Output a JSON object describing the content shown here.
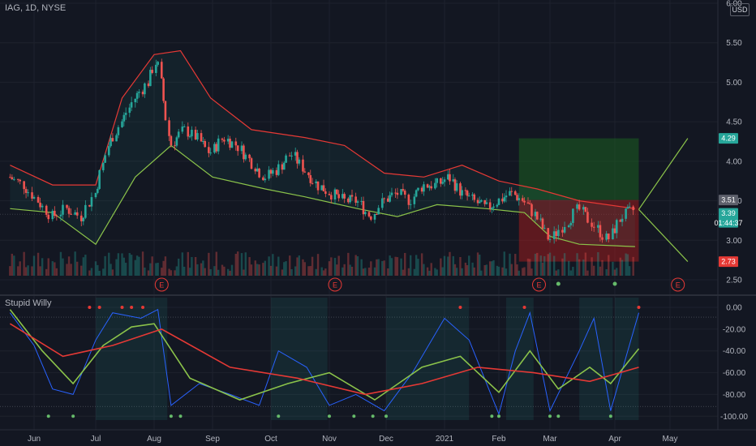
{
  "header": {
    "symbol": "IAG, 1D, NYSE",
    "currency": "USD"
  },
  "indicator": {
    "name": "Stupid Willy"
  },
  "colors": {
    "bg": "#131722",
    "grid": "#1e222d",
    "up": "#26a69a",
    "down": "#ef5350",
    "bb_upper": "#e53935",
    "bb_lower": "#8bc34a",
    "osc_fast": "#2962ff",
    "osc_slow": "#8bc34a",
    "osc_mid": "#e53935"
  },
  "price_badges": {
    "tp": "4.29",
    "entry": "3.51",
    "last": "3.39",
    "countdown": "01:44:37",
    "sl": "2.73"
  },
  "earnings_marker": "E",
  "chart_data": [
    {
      "type": "candlestick",
      "title": "IAG, 1D, NYSE",
      "x_ticks": [
        "Jun",
        "Jul",
        "Aug",
        "Sep",
        "Oct",
        "Nov",
        "Dec",
        "2021",
        "Feb",
        "Mar",
        "Apr",
        "May"
      ],
      "y_ticks": [
        "2.50",
        "3.00",
        "3.50",
        "4.00",
        "4.50",
        "5.00",
        "5.50",
        "6.00"
      ],
      "ylim": [
        2.5,
        6.0
      ],
      "close_path": [
        {
          "date": "2020-05-20",
          "price": 3.8
        },
        {
          "date": "2020-05-27",
          "price": 3.7
        },
        {
          "date": "2020-06-03",
          "price": 3.5
        },
        {
          "date": "2020-06-10",
          "price": 3.3
        },
        {
          "date": "2020-06-17",
          "price": 3.4
        },
        {
          "date": "2020-06-24",
          "price": 3.3
        },
        {
          "date": "2020-07-01",
          "price": 3.6
        },
        {
          "date": "2020-07-08",
          "price": 4.2
        },
        {
          "date": "2020-07-15",
          "price": 4.5
        },
        {
          "date": "2020-07-22",
          "price": 4.8
        },
        {
          "date": "2020-07-29",
          "price": 5.0
        },
        {
          "date": "2020-08-03",
          "price": 5.3
        },
        {
          "date": "2020-08-10",
          "price": 4.2
        },
        {
          "date": "2020-08-17",
          "price": 4.4
        },
        {
          "date": "2020-08-24",
          "price": 4.3
        },
        {
          "date": "2020-08-31",
          "price": 4.1
        },
        {
          "date": "2020-09-07",
          "price": 4.3
        },
        {
          "date": "2020-09-14",
          "price": 4.2
        },
        {
          "date": "2020-09-21",
          "price": 4.0
        },
        {
          "date": "2020-09-28",
          "price": 3.8
        },
        {
          "date": "2020-10-05",
          "price": 3.9
        },
        {
          "date": "2020-10-12",
          "price": 4.1
        },
        {
          "date": "2020-10-19",
          "price": 3.9
        },
        {
          "date": "2020-10-26",
          "price": 3.7
        },
        {
          "date": "2020-11-02",
          "price": 3.6
        },
        {
          "date": "2020-11-09",
          "price": 3.5
        },
        {
          "date": "2020-11-16",
          "price": 3.5
        },
        {
          "date": "2020-11-23",
          "price": 3.3
        },
        {
          "date": "2020-11-30",
          "price": 3.5
        },
        {
          "date": "2020-12-07",
          "price": 3.6
        },
        {
          "date": "2020-12-14",
          "price": 3.5
        },
        {
          "date": "2020-12-21",
          "price": 3.7
        },
        {
          "date": "2020-12-28",
          "price": 3.7
        },
        {
          "date": "2021-01-04",
          "price": 3.8
        },
        {
          "date": "2021-01-11",
          "price": 3.6
        },
        {
          "date": "2021-01-18",
          "price": 3.5
        },
        {
          "date": "2021-01-25",
          "price": 3.4
        },
        {
          "date": "2021-02-01",
          "price": 3.5
        },
        {
          "date": "2021-02-08",
          "price": 3.6
        },
        {
          "date": "2021-02-15",
          "price": 3.5
        },
        {
          "date": "2021-02-22",
          "price": 3.3
        },
        {
          "date": "2021-03-01",
          "price": 3.0
        },
        {
          "date": "2021-03-08",
          "price": 3.2
        },
        {
          "date": "2021-03-15",
          "price": 3.4
        },
        {
          "date": "2021-03-22",
          "price": 3.2
        },
        {
          "date": "2021-03-29",
          "price": 3.0
        },
        {
          "date": "2021-04-05",
          "price": 3.3
        },
        {
          "date": "2021-04-12",
          "price": 3.39
        }
      ],
      "bb_upper": [
        {
          "date": "2020-05-20",
          "price": 3.95
        },
        {
          "date": "2020-06-10",
          "price": 3.7
        },
        {
          "date": "2020-07-01",
          "price": 3.7
        },
        {
          "date": "2020-07-15",
          "price": 4.8
        },
        {
          "date": "2020-08-01",
          "price": 5.35
        },
        {
          "date": "2020-08-15",
          "price": 5.4
        },
        {
          "date": "2020-08-31",
          "price": 4.8
        },
        {
          "date": "2020-09-21",
          "price": 4.4
        },
        {
          "date": "2020-10-19",
          "price": 4.3
        },
        {
          "date": "2020-11-09",
          "price": 4.2
        },
        {
          "date": "2020-11-30",
          "price": 3.85
        },
        {
          "date": "2020-12-21",
          "price": 3.8
        },
        {
          "date": "2021-01-11",
          "price": 3.95
        },
        {
          "date": "2021-02-01",
          "price": 3.75
        },
        {
          "date": "2021-02-22",
          "price": 3.65
        },
        {
          "date": "2021-03-15",
          "price": 3.5
        },
        {
          "date": "2021-04-12",
          "price": 3.4
        }
      ],
      "bb_lower": [
        {
          "date": "2020-05-20",
          "price": 3.4
        },
        {
          "date": "2020-06-10",
          "price": 3.35
        },
        {
          "date": "2020-07-01",
          "price": 2.95
        },
        {
          "date": "2020-07-22",
          "price": 3.8
        },
        {
          "date": "2020-08-10",
          "price": 4.2
        },
        {
          "date": "2020-09-01",
          "price": 3.8
        },
        {
          "date": "2020-09-28",
          "price": 3.65
        },
        {
          "date": "2020-10-19",
          "price": 3.55
        },
        {
          "date": "2020-11-16",
          "price": 3.4
        },
        {
          "date": "2020-12-07",
          "price": 3.3
        },
        {
          "date": "2020-12-28",
          "price": 3.45
        },
        {
          "date": "2021-01-25",
          "price": 3.4
        },
        {
          "date": "2021-02-15",
          "price": 3.35
        },
        {
          "date": "2021-03-01",
          "price": 3.05
        },
        {
          "date": "2021-03-15",
          "price": 2.95
        },
        {
          "date": "2021-04-12",
          "price": 2.92
        }
      ],
      "position": {
        "entry": 3.51,
        "take_profit": 4.29,
        "stop_loss": 2.73,
        "start": "2021-02-12",
        "end": "2021-04-14",
        "projection_from": "2021-04-14",
        "projection_to": "2021-05-10"
      },
      "earnings_dates": [
        "2020-08-05",
        "2020-11-04",
        "2021-02-23",
        "2021-05-05"
      ],
      "dividend_dates": [
        "2021-03-05",
        "2021-04-01"
      ]
    },
    {
      "type": "line",
      "title": "Stupid Willy",
      "y_ticks": [
        "0.00",
        "-20.00",
        "-40.00",
        "-60.00",
        "-80.00",
        "-100.00"
      ],
      "ylim": [
        -105,
        3
      ],
      "series": [
        {
          "values": [
            {
              "date": "2020-05-20",
              "v": -5
            },
            {
              "date": "2020-06-01",
              "v": -35
            },
            {
              "date": "2020-06-10",
              "v": -75
            },
            {
              "date": "2020-06-20",
              "v": -80
            },
            {
              "date": "2020-07-01",
              "v": -30
            },
            {
              "date": "2020-07-10",
              "v": -5
            },
            {
              "date": "2020-07-25",
              "v": -10
            },
            {
              "date": "2020-08-03",
              "v": -2
            },
            {
              "date": "2020-08-10",
              "v": -90
            },
            {
              "date": "2020-08-25",
              "v": -70
            },
            {
              "date": "2020-09-10",
              "v": -80
            },
            {
              "date": "2020-09-25",
              "v": -90
            },
            {
              "date": "2020-10-05",
              "v": -40
            },
            {
              "date": "2020-10-20",
              "v": -55
            },
            {
              "date": "2020-11-01",
              "v": -90
            },
            {
              "date": "2020-11-15",
              "v": -80
            },
            {
              "date": "2020-11-30",
              "v": -95
            },
            {
              "date": "2020-12-15",
              "v": -60
            },
            {
              "date": "2021-01-01",
              "v": -10
            },
            {
              "date": "2021-01-15",
              "v": -30
            },
            {
              "date": "2021-02-01",
              "v": -98
            },
            {
              "date": "2021-02-10",
              "v": -40
            },
            {
              "date": "2021-02-18",
              "v": -5
            },
            {
              "date": "2021-03-01",
              "v": -95
            },
            {
              "date": "2021-03-15",
              "v": -40
            },
            {
              "date": "2021-03-22",
              "v": -10
            },
            {
              "date": "2021-03-30",
              "v": -95
            },
            {
              "date": "2021-04-08",
              "v": -40
            },
            {
              "date": "2021-04-14",
              "v": -5
            }
          ]
        },
        {
          "values": [
            {
              "date": "2020-05-20",
              "v": -2
            },
            {
              "date": "2020-06-05",
              "v": -40
            },
            {
              "date": "2020-06-20",
              "v": -70
            },
            {
              "date": "2020-07-05",
              "v": -35
            },
            {
              "date": "2020-07-20",
              "v": -18
            },
            {
              "date": "2020-08-01",
              "v": -15
            },
            {
              "date": "2020-08-20",
              "v": -65
            },
            {
              "date": "2020-09-15",
              "v": -85
            },
            {
              "date": "2020-10-10",
              "v": -70
            },
            {
              "date": "2020-11-01",
              "v": -60
            },
            {
              "date": "2020-11-25",
              "v": -85
            },
            {
              "date": "2020-12-20",
              "v": -55
            },
            {
              "date": "2021-01-10",
              "v": -45
            },
            {
              "date": "2021-02-01",
              "v": -78
            },
            {
              "date": "2021-02-18",
              "v": -40
            },
            {
              "date": "2021-03-05",
              "v": -75
            },
            {
              "date": "2021-03-20",
              "v": -55
            },
            {
              "date": "2021-03-30",
              "v": -70
            },
            {
              "date": "2021-04-14",
              "v": -38
            }
          ]
        },
        {
          "values": [
            {
              "date": "2020-05-20",
              "v": -15
            },
            {
              "date": "2020-06-15",
              "v": -45
            },
            {
              "date": "2020-07-10",
              "v": -35
            },
            {
              "date": "2020-08-05",
              "v": -20
            },
            {
              "date": "2020-09-10",
              "v": -55
            },
            {
              "date": "2020-10-15",
              "v": -65
            },
            {
              "date": "2020-11-20",
              "v": -80
            },
            {
              "date": "2020-12-20",
              "v": -70
            },
            {
              "date": "2021-01-20",
              "v": -55
            },
            {
              "date": "2021-02-20",
              "v": -60
            },
            {
              "date": "2021-03-20",
              "v": -68
            },
            {
              "date": "2021-04-14",
              "v": -55
            }
          ]
        }
      ]
    }
  ]
}
